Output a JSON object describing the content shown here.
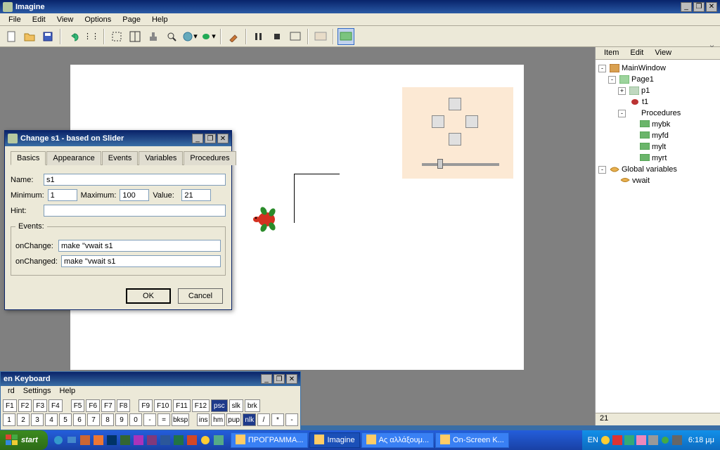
{
  "app": {
    "title": "Imagine"
  },
  "menu": {
    "file": "File",
    "edit": "Edit",
    "view": "View",
    "options": "Options",
    "page": "Page",
    "help": "Help"
  },
  "sidemenu": {
    "item": "Item",
    "edit": "Edit",
    "view": "View"
  },
  "tree": {
    "root": "MainWindow",
    "page": "Page1",
    "p1": "p1",
    "t1": "t1",
    "procs": "Procedures",
    "mybk": "mybk",
    "myfd": "myfd",
    "mylt": "mylt",
    "myrt": "myrt",
    "globals": "Global variables",
    "vwait": "vwait"
  },
  "status": "21",
  "dialog": {
    "title": "Change s1  -  based on Slider",
    "tabs": {
      "basics": "Basics",
      "appearance": "Appearance",
      "events": "Events",
      "variables": "Variables",
      "procedures": "Procedures"
    },
    "labels": {
      "name": "Name:",
      "min": "Minimum:",
      "max": "Maximum:",
      "value": "Value:",
      "hint": "Hint:",
      "events_legend": "Events:",
      "onchange": "onChange:",
      "onchanged": "onChanged:"
    },
    "values": {
      "name": "s1",
      "min": "1",
      "max": "100",
      "value": "21",
      "hint": "",
      "onchange": "make \"vwait s1",
      "onchanged": "make \"vwait s1"
    },
    "buttons": {
      "ok": "OK",
      "cancel": "Cancel"
    }
  },
  "osk": {
    "title": "en Keyboard",
    "menu": {
      "rd": "rd",
      "settings": "Settings",
      "help": "Help"
    },
    "row1": [
      "F1",
      "F2",
      "F3",
      "F4",
      "",
      "F5",
      "F6",
      "F7",
      "F8",
      "",
      "F9",
      "F10",
      "F11",
      "F12",
      "psc",
      "slk",
      "brk"
    ],
    "row2": [
      "1",
      "2",
      "3",
      "4",
      "5",
      "6",
      "7",
      "8",
      "9",
      "0",
      "-",
      "=",
      "bksp",
      "",
      "ins",
      "hm",
      "pup",
      "nlk",
      "/",
      "*",
      "-"
    ]
  },
  "taskbar": {
    "start": "start",
    "items": [
      {
        "label": "ΠΡΟΓΡΑΜΜΑ...",
        "active": false
      },
      {
        "label": "Imagine",
        "active": true
      },
      {
        "label": "Ας αλλάξουμ...",
        "active": false
      },
      {
        "label": "On-Screen K...",
        "active": false
      }
    ],
    "lang": "EN",
    "time": "6:18 μμ"
  }
}
